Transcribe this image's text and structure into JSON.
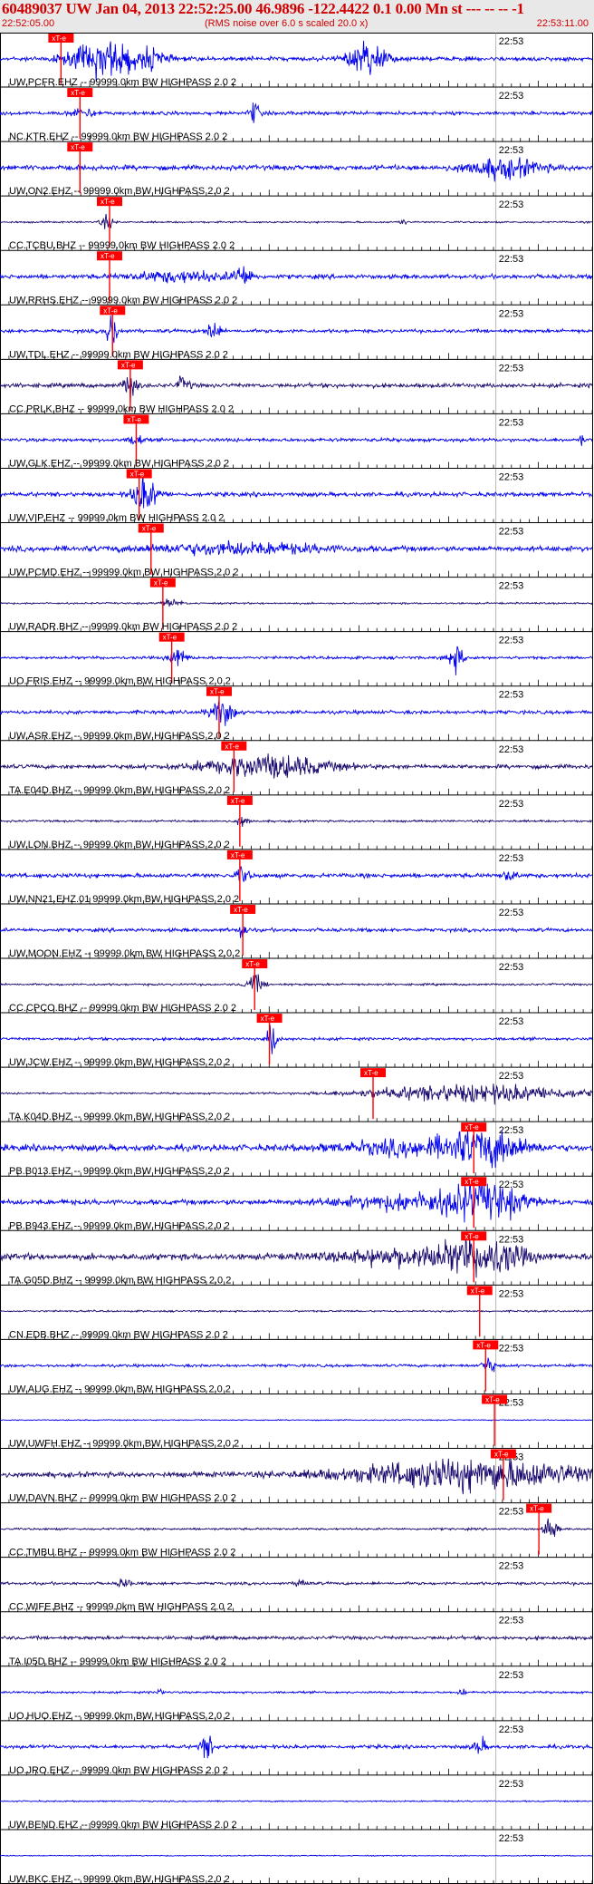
{
  "header": {
    "title": "60489037 UW Jan 04, 2013 22:52:25.00   46.9896 -122.4422  0.1 0.00 Mn st --- -- --   -1",
    "start_time": "22:52:05.00",
    "subtitle": "(RMS noise over 6.0 s scaled 20.0 x)",
    "end_time": "22:53:11.00"
  },
  "colors": {
    "title": "#d00000",
    "blue": "#0000ee",
    "navy": "#1a0a6e",
    "pick": "#ff0000",
    "header_bg": "#e8e8e8"
  },
  "chart_data": {
    "type": "line",
    "title": "60489037 UW Jan 04, 2013 22:52:25.00   46.9896 -122.4422  0.1 0.00 Mn st --- -- --   -1",
    "x_start": "22:52:05.00",
    "x_end": "22:53:11.00",
    "minute_mark": "22:53",
    "pick_label": "xT-e",
    "traces": [
      {
        "label": "UW.PCFR.EHZ -- 99999.0km BW  HIGHPASS  2.0  2",
        "color": "blue",
        "noise": 0.12,
        "pick": 0.103,
        "bursts": [
          [
            0.18,
            0.06,
            1.0
          ],
          [
            0.62,
            0.03,
            1.0
          ],
          [
            0.26,
            0.02,
            0.4
          ]
        ]
      },
      {
        "label": "NC.KTR.EHZ -- 99999.0km BW  HIGHPASS  2.0  2",
        "color": "blue",
        "noise": 0.1,
        "pick": 0.135,
        "bursts": [
          [
            0.43,
            0.008,
            0.7
          ],
          [
            0.14,
            0.02,
            0.25
          ]
        ]
      },
      {
        "label": "UW.ON2.EHZ -- 99999.0km BW  HIGHPASS  2.0  2",
        "color": "blue",
        "noise": 0.14,
        "pick": 0.135,
        "bursts": [
          [
            0.85,
            0.06,
            0.55
          ]
        ]
      },
      {
        "label": "CC.TCBU.BHZ -- 99999.0km BW  HIGHPASS  2.0  2",
        "color": "navy",
        "noise": 0.05,
        "pick": 0.185,
        "bursts": [
          [
            0.18,
            0.01,
            0.4
          ],
          [
            0.68,
            0.005,
            0.3
          ]
        ]
      },
      {
        "label": "UW.RRHS.EHZ -- 99999.0km BW  HIGHPASS  2.0  2",
        "color": "blue",
        "noise": 0.12,
        "pick": 0.185,
        "bursts": [
          [
            0.41,
            0.015,
            0.6
          ],
          [
            0.3,
            0.08,
            0.3
          ]
        ]
      },
      {
        "label": "UW.TDL.EHZ -- 99999.0km BW  HIGHPASS  2.0  2",
        "color": "blue",
        "noise": 0.1,
        "pick": 0.19,
        "bursts": [
          [
            0.19,
            0.01,
            1.0
          ],
          [
            0.36,
            0.01,
            0.7
          ]
        ]
      },
      {
        "label": "CC.PRLK.BHZ -- 99999.0km BW  HIGHPASS  2.0  2",
        "color": "navy",
        "noise": 0.12,
        "pick": 0.22,
        "bursts": [
          [
            0.22,
            0.01,
            1.0
          ],
          [
            0.31,
            0.01,
            0.5
          ]
        ]
      },
      {
        "label": "UW.GLK.EHZ -- 99999.0km BW  HIGHPASS  2.0  2",
        "color": "blue",
        "noise": 0.1,
        "pick": 0.23,
        "bursts": [
          [
            0.23,
            0.01,
            0.4
          ],
          [
            0.98,
            0.004,
            0.5
          ]
        ]
      },
      {
        "label": "UW.VIP.EHZ -- 99999.0km BW  HIGHPASS  2.0  2",
        "color": "blue",
        "noise": 0.12,
        "pick": 0.235,
        "bursts": [
          [
            0.245,
            0.02,
            1.0
          ]
        ]
      },
      {
        "label": "UW.PCMD.EHZ -- 99999.0km BW  HIGHPASS  2.0  2",
        "color": "blue",
        "noise": 0.15,
        "pick": 0.255,
        "bursts": [
          [
            0.4,
            0.15,
            0.3
          ]
        ]
      },
      {
        "label": "UW.RADR.BHZ -- 99999.0km BW  HIGHPASS  2.0  2",
        "color": "navy",
        "noise": 0.05,
        "pick": 0.275,
        "bursts": [
          [
            0.29,
            0.015,
            0.25
          ]
        ]
      },
      {
        "label": "UO.FRIS.EHZ -- 99999.0km BW  HIGHPASS  2.0  2",
        "color": "blue",
        "noise": 0.08,
        "pick": 0.29,
        "bursts": [
          [
            0.3,
            0.015,
            0.5
          ],
          [
            0.77,
            0.015,
            0.7
          ]
        ]
      },
      {
        "label": "UW.ASR.EHZ -- 99999.0km BW  HIGHPASS  2.0  2",
        "color": "blue",
        "noise": 0.1,
        "pick": 0.37,
        "bursts": [
          [
            0.375,
            0.02,
            0.7
          ]
        ]
      },
      {
        "label": "TA.E04D.BHZ -- 99999.0km BW  HIGHPASS  2.0  2",
        "color": "navy",
        "noise": 0.12,
        "pick": 0.395,
        "bursts": [
          [
            0.45,
            0.1,
            0.65
          ]
        ]
      },
      {
        "label": "UW.LON.BHZ -- 99999.0km BW  HIGHPASS  2.0  2",
        "color": "navy",
        "noise": 0.06,
        "pick": 0.405,
        "bursts": [
          [
            0.41,
            0.01,
            0.3
          ]
        ]
      },
      {
        "label": "UW.NN21.EHZ.01 99999.0km BW  HIGHPASS  2.0  2",
        "color": "blue",
        "noise": 0.12,
        "pick": 0.405,
        "bursts": [
          [
            0.41,
            0.01,
            0.5
          ],
          [
            0.86,
            0.01,
            0.4
          ]
        ]
      },
      {
        "label": "UW.MOON.EHZ -- 99999.0km BW  HIGHPASS  2.0  2",
        "color": "blue",
        "noise": 0.1,
        "pick": 0.41,
        "bursts": [
          [
            0.41,
            0.008,
            0.5
          ]
        ]
      },
      {
        "label": "CC.CPCO.BHZ -- 99999.0km BW  HIGHPASS  2.0  2",
        "color": "navy",
        "noise": 0.06,
        "pick": 0.43,
        "bursts": [
          [
            0.43,
            0.015,
            0.5
          ]
        ]
      },
      {
        "label": "UW.JCW.EHZ -- 99999.0km BW  HIGHPASS  2.0  2",
        "color": "blue",
        "noise": 0.08,
        "pick": 0.455,
        "bursts": [
          [
            0.46,
            0.008,
            1.0
          ]
        ]
      },
      {
        "label": "TA.K04D.BHZ -- 99999.0km BW  HIGHPASS  2.0  2",
        "color": "navy",
        "noise": 0.05,
        "pick": 0.63,
        "bursts": [
          [
            0.8,
            0.18,
            0.5
          ]
        ]
      },
      {
        "label": "PB.B013.EHZ -- 99999.0km BW  HIGHPASS  2.0  2",
        "color": "blue",
        "noise": 0.18,
        "pick": 0.8,
        "bursts": [
          [
            0.82,
            0.06,
            1.0
          ],
          [
            0.7,
            0.12,
            0.4
          ]
        ]
      },
      {
        "label": "PB.B943.EHZ -- 99999.0km BW  HIGHPASS  2.0  2",
        "color": "blue",
        "noise": 0.15,
        "pick": 0.8,
        "bursts": [
          [
            0.82,
            0.06,
            1.0
          ],
          [
            0.7,
            0.12,
            0.45
          ]
        ]
      },
      {
        "label": "TA.G05D.BHZ -- 99999.0km BW  HIGHPASS  2.0  2",
        "color": "navy",
        "noise": 0.18,
        "pick": 0.8,
        "bursts": [
          [
            0.82,
            0.06,
            1.0
          ],
          [
            0.7,
            0.12,
            0.5
          ]
        ]
      },
      {
        "label": "CN.EDB.BHZ -- 99999.0km BW  HIGHPASS  2.0  2",
        "color": "navy",
        "noise": 0.05,
        "pick": 0.81,
        "bursts": []
      },
      {
        "label": "UW.AUG.EHZ -- 99999.0km BW  HIGHPASS  2.0  2",
        "color": "blue",
        "noise": 0.08,
        "pick": 0.82,
        "bursts": [
          [
            0.825,
            0.01,
            0.5
          ]
        ]
      },
      {
        "label": "UW.UWFH.EHZ -- 99999.0km BW  HIGHPASS  2.0  2",
        "color": "blue",
        "noise": 0.03,
        "pick": 0.835,
        "bursts": []
      },
      {
        "label": "UW.DAVN.BHZ -- 99999.0km BW  HIGHPASS  2.0  2",
        "color": "navy",
        "noise": 0.15,
        "pick": 0.85,
        "bursts": [
          [
            0.8,
            0.2,
            0.85
          ]
        ]
      },
      {
        "label": "CC.TMBU.BHZ -- 99999.0km BW  HIGHPASS  2.0  2",
        "color": "navy",
        "noise": 0.06,
        "pick": 0.91,
        "bursts": [
          [
            0.93,
            0.01,
            0.7
          ]
        ]
      },
      {
        "label": "CC.WIFE.BHZ -- 99999.0km BW  HIGHPASS  2.0  2",
        "color": "navy",
        "noise": 0.08,
        "pick": null,
        "bursts": [
          [
            0.21,
            0.008,
            0.4
          ],
          [
            0.51,
            0.008,
            0.4
          ]
        ]
      },
      {
        "label": "TA.I05D.BHZ -- 99999.0km BW  HIGHPASS  2.0  2",
        "color": "navy",
        "noise": 0.1,
        "pick": null,
        "bursts": []
      },
      {
        "label": "UO.HUO.EHZ -- 99999.0km BW  HIGHPASS  2.0  2",
        "color": "blue",
        "noise": 0.06,
        "pick": null,
        "bursts": [
          [
            0.27,
            0.005,
            0.3
          ],
          [
            0.78,
            0.005,
            0.3
          ]
        ]
      },
      {
        "label": "UO.JRO.EHZ -- 99999.0km BW  HIGHPASS  2.0  2",
        "color": "blue",
        "noise": 0.1,
        "pick": null,
        "bursts": [
          [
            0.35,
            0.012,
            0.65
          ],
          [
            0.81,
            0.01,
            0.5
          ]
        ]
      },
      {
        "label": "UW.BEND.EHZ -- 99999.0km BW  HIGHPASS  2.0  2",
        "color": "blue",
        "noise": 0.04,
        "pick": null,
        "bursts": []
      },
      {
        "label": "UW.BKC.EHZ -- 99999.0km BW  HIGHPASS  2.0  2",
        "color": "blue",
        "noise": 0.03,
        "pick": null,
        "bursts": []
      }
    ]
  }
}
